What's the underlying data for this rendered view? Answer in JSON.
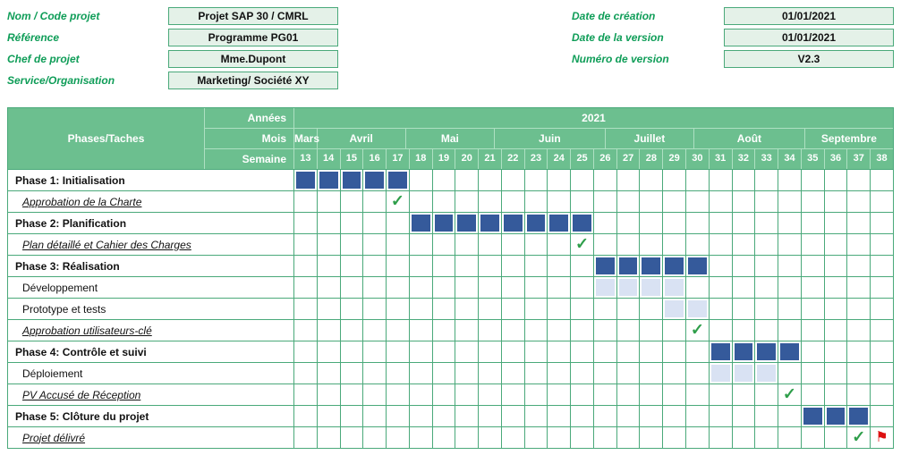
{
  "meta_left": [
    {
      "label": "Nom / Code projet",
      "value": "Projet SAP 30 / CMRL"
    },
    {
      "label": "Référence",
      "value": "Programme PG01"
    },
    {
      "label": "Chef de projet",
      "value": "Mme.Dupont"
    },
    {
      "label": "Service/Organisation",
      "value": "Marketing/ Société XY"
    }
  ],
  "meta_right": [
    {
      "label": "Date de création",
      "value": "01/01/2021"
    },
    {
      "label": "Date de la version",
      "value": "01/01/2021"
    },
    {
      "label": "Numéro de version",
      "value": "V2.3"
    }
  ],
  "head": {
    "phases": "Phases/Taches",
    "annees": "Années",
    "mois": "Mois",
    "semaine": "Semaine",
    "year": "2021"
  },
  "months": [
    {
      "name": "Mars",
      "span": 1
    },
    {
      "name": "Avril",
      "span": 4
    },
    {
      "name": "Mai",
      "span": 4
    },
    {
      "name": "Juin",
      "span": 5
    },
    {
      "name": "Juillet",
      "span": 4
    },
    {
      "name": "Août",
      "span": 5
    },
    {
      "name": "Septembre",
      "span": 4
    }
  ],
  "weeks": [
    13,
    14,
    15,
    16,
    17,
    18,
    19,
    20,
    21,
    22,
    23,
    24,
    25,
    26,
    27,
    28,
    29,
    30,
    31,
    32,
    33,
    34,
    35,
    36,
    37,
    38
  ],
  "rows": [
    {
      "name": "Phase 1: Initialisation",
      "style": "phase",
      "bars_dark": [
        13,
        14,
        15,
        16,
        17
      ]
    },
    {
      "name": "Approbation de la Charte",
      "style": "milestone",
      "check_at": 17
    },
    {
      "name": "Phase 2: Planification",
      "style": "phase",
      "bars_dark": [
        18,
        19,
        20,
        21,
        22,
        23,
        24,
        25
      ]
    },
    {
      "name": "Plan détaillé et Cahier des Charges",
      "style": "milestone",
      "check_at": 25
    },
    {
      "name": "Phase 3: Réalisation",
      "style": "phase",
      "bars_dark": [
        26,
        27,
        28,
        29,
        30
      ]
    },
    {
      "name": "Développement",
      "style": "sub",
      "bars_light": [
        26,
        27,
        28,
        29
      ]
    },
    {
      "name": "Prototype et tests",
      "style": "sub",
      "bars_light": [
        29,
        30
      ]
    },
    {
      "name": "Approbation utilisateurs-clé",
      "style": "milestone",
      "check_at": 30
    },
    {
      "name": "Phase 4: Contrôle et suivi",
      "style": "phase",
      "bars_dark": [
        31,
        32,
        33,
        34
      ]
    },
    {
      "name": "Déploiement",
      "style": "sub",
      "bars_light": [
        31,
        32,
        33
      ]
    },
    {
      "name": "PV Accusé de Réception",
      "style": "milestone",
      "check_at": 34
    },
    {
      "name": "Phase 5: Clôture du projet",
      "style": "phase",
      "bars_dark": [
        35,
        36,
        37
      ]
    },
    {
      "name": "Projet délivré",
      "style": "milestone",
      "check_at": 37,
      "flag_at": 38
    }
  ],
  "chart_data": {
    "type": "bar",
    "title": "Gantt — Phases/Taches vs Semaines 2021",
    "xlabel": "Semaine",
    "ylabel": "Phases/Taches",
    "categories": [
      13,
      14,
      15,
      16,
      17,
      18,
      19,
      20,
      21,
      22,
      23,
      24,
      25,
      26,
      27,
      28,
      29,
      30,
      31,
      32,
      33,
      34,
      35,
      36,
      37,
      38
    ],
    "series": [
      {
        "name": "Phase 1: Initialisation",
        "type": "phase",
        "start": 13,
        "end": 17
      },
      {
        "name": "Approbation de la Charte",
        "type": "milestone",
        "week": 17
      },
      {
        "name": "Phase 2: Planification",
        "type": "phase",
        "start": 18,
        "end": 25
      },
      {
        "name": "Plan détaillé et Cahier des Charges",
        "type": "milestone",
        "week": 25
      },
      {
        "name": "Phase 3: Réalisation",
        "type": "phase",
        "start": 26,
        "end": 30
      },
      {
        "name": "Développement",
        "type": "task",
        "start": 26,
        "end": 29
      },
      {
        "name": "Prototype et tests",
        "type": "task",
        "start": 29,
        "end": 30
      },
      {
        "name": "Approbation utilisateurs-clé",
        "type": "milestone",
        "week": 30
      },
      {
        "name": "Phase 4: Contrôle et suivi",
        "type": "phase",
        "start": 31,
        "end": 34
      },
      {
        "name": "Déploiement",
        "type": "task",
        "start": 31,
        "end": 33
      },
      {
        "name": "PV Accusé de Réception",
        "type": "milestone",
        "week": 34
      },
      {
        "name": "Phase 5: Clôture du projet",
        "type": "phase",
        "start": 35,
        "end": 37
      },
      {
        "name": "Projet délivré",
        "type": "milestone",
        "week": 37,
        "flag": 38
      }
    ],
    "xlim": [
      13,
      38
    ]
  }
}
